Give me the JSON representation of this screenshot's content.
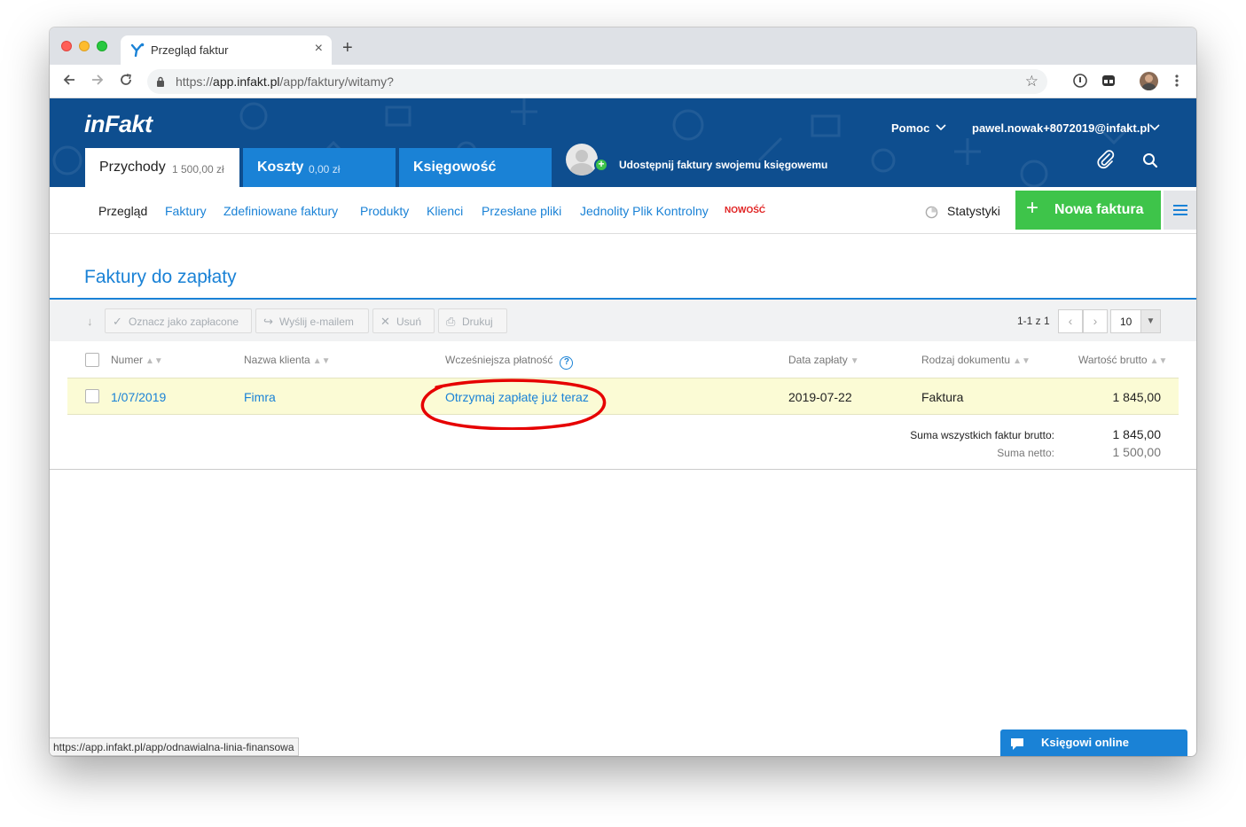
{
  "browser": {
    "tab_title": "Przegląd faktur",
    "tab_close": "×",
    "new_tab": "+",
    "url_scheme": "https://",
    "url_host": "app.infakt.pl",
    "url_path": "/app/faktury/witamy?"
  },
  "header": {
    "logo": "inFakt",
    "help_label": "Pomoc",
    "user_email": "pawel.nowak+8072019@infakt.pl",
    "tabs": [
      {
        "label": "Przychody",
        "amount": "1 500,00 zł"
      },
      {
        "label": "Koszty",
        "amount": "0,00 zł"
      },
      {
        "label": "Księgowość"
      }
    ],
    "share_text": "Udostępnij faktury swojemu księgowemu",
    "brand_color": "#0e4e8f",
    "accent_color": "#1a82d6"
  },
  "subnav": {
    "items": [
      "Przegląd",
      "Faktury",
      "Zdefiniowane faktury",
      "Produkty",
      "Klienci",
      "Przesłane pliki",
      "Jednolity Plik Kontrolny"
    ],
    "new_badge": "NOWOŚĆ",
    "stats_label": "Statystyki",
    "new_invoice_label": "Nowa faktura",
    "new_invoice_color": "#3ec44a"
  },
  "page": {
    "title": "Faktury do zapłaty",
    "actions": [
      "Oznacz jako zapłacone",
      "Wyślij e-mailem",
      "Usuń",
      "Drukuj"
    ],
    "pager_text": "1-1 z 1",
    "per_page": "10"
  },
  "table": {
    "columns": [
      "Numer",
      "Nazwa klienta",
      "Wcześniejsza płatność",
      "Data zapłaty",
      "Rodzaj dokumentu",
      "Wartość brutto"
    ],
    "rows": [
      {
        "numer": "1/07/2019",
        "klient": "Fimra",
        "platnosc": "Otrzymaj zapłatę już teraz",
        "data": "2019-07-22",
        "rodzaj": "Faktura",
        "wartosc": "1 845,00"
      }
    ],
    "summary": {
      "brutto_label": "Suma wszystkich faktur brutto:",
      "brutto_value": "1 845,00",
      "netto_label": "Suma netto:",
      "netto_value": "1 500,00"
    },
    "highlight_color": "#fbfbd5"
  },
  "status_bar_url": "https://app.infakt.pl/app/odnawialna-linia-finansowa",
  "chat": {
    "label": "Księgowi online"
  }
}
